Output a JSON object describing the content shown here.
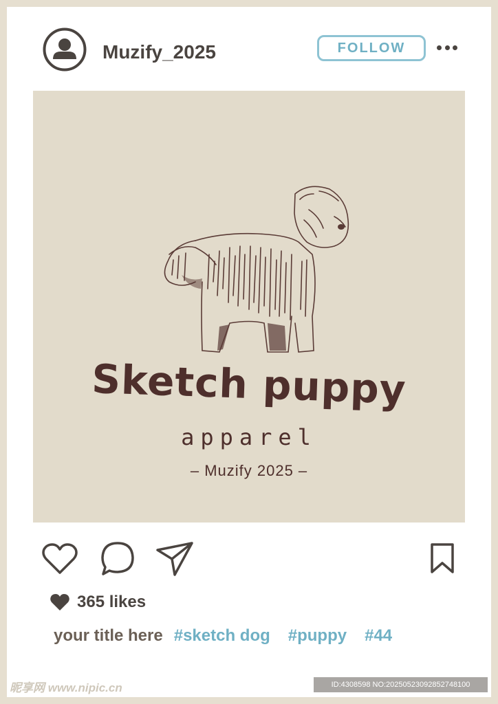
{
  "header": {
    "username": "Muzify_2025",
    "follow_label": "FOLLOW",
    "avatar_icon": "user-avatar-icon",
    "more_icon": "more-dots-icon"
  },
  "post": {
    "brand_title": "Sketch puppy",
    "brand_subtitle": "apparel",
    "brand_line": "– Muzify 2025 –"
  },
  "actions": {
    "like_icon": "heart-outline-icon",
    "comment_icon": "comment-bubble-icon",
    "share_icon": "paper-plane-icon",
    "save_icon": "bookmark-icon"
  },
  "likes": {
    "text": "365 likes"
  },
  "caption": {
    "title": "your title here",
    "hashtags": [
      "#sketch dog",
      "#puppy",
      "#44"
    ]
  },
  "watermark": {
    "left": "昵享网 www.nipic.cn",
    "right": "ID:4308598 NO:20250523092852748100"
  },
  "colors": {
    "accent": "#6fb0c4",
    "text_dark": "#4a4440",
    "brand_brown": "#4e2f2c",
    "image_bg": "#e2dbcb"
  }
}
